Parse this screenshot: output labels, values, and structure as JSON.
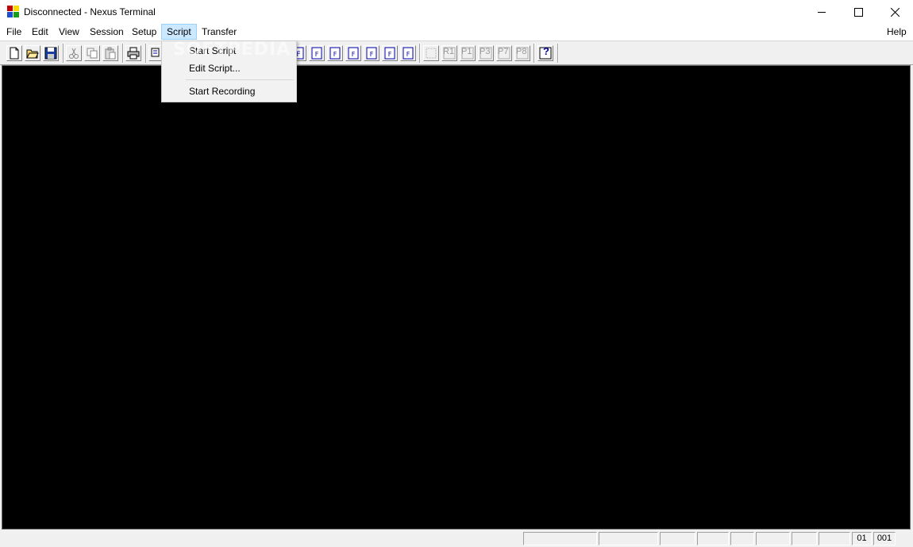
{
  "window": {
    "title": "Disconnected - Nexus Terminal",
    "min_glyph": "",
    "max_glyph": "",
    "close_glyph": ""
  },
  "menubar": {
    "items": [
      "File",
      "Edit",
      "View",
      "Session",
      "Setup",
      "Script",
      "Transfer"
    ],
    "help": "Help",
    "active": "Script"
  },
  "script_menu": {
    "items": [
      "Start Script",
      "Edit Script...",
      "Start Recording"
    ]
  },
  "toolbar": {
    "macro_labels": [
      "R1",
      "P1",
      "P3",
      "P7",
      "P8"
    ],
    "help_glyph": "?"
  },
  "watermark": "SOFTPEDIA",
  "statusbar": {
    "line": "01",
    "column": "001"
  },
  "colors": {
    "terminal_bg": "#000000",
    "menu_highlight": "#cce8ff",
    "toolbar_icon_blue": "#0000aa"
  }
}
